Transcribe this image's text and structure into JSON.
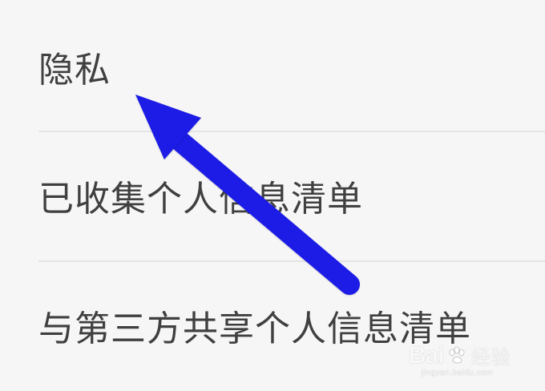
{
  "settings": {
    "items": [
      {
        "label": "隐私"
      },
      {
        "label": "已收集个人信息清单"
      },
      {
        "label": "与第三方共享个人信息清单"
      }
    ]
  },
  "annotation": {
    "arrow_color": "#1a1ae6",
    "arrow_icon": "pointer-arrow-icon"
  },
  "watermark": {
    "brand": "Bai",
    "experience": "经验",
    "domain": "jingyan.baidu.com"
  }
}
